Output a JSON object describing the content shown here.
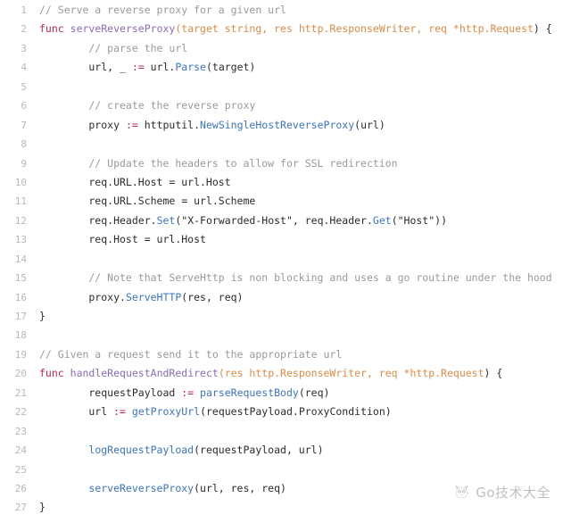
{
  "editor": {
    "language": "go",
    "background_color": "#ffffff",
    "line_number_color": "#b8b8b8",
    "default_text_color": "#2b2b2b",
    "first_line_number": 1,
    "last_line_number": 27,
    "total_lines": 27
  },
  "theme_colors": {
    "comment": "#9a9a9a",
    "keyword": "#c7254e",
    "function_name": "#8a6bbd",
    "parameter_type": "#e08a45",
    "function_call": "#3b74c4",
    "plain": "#2b2b2b",
    "operator": "#c7254e"
  },
  "watermark": {
    "icon": "wechat-gopher-icon",
    "text": "Go技术大全"
  },
  "lines": [
    {
      "number": "1",
      "tokens": [
        {
          "t": "comment",
          "s": "// Serve a reverse proxy for a given url"
        }
      ]
    },
    {
      "number": "2",
      "tokens": [
        {
          "t": "keyword",
          "s": "func"
        },
        {
          "t": "plain",
          "s": " "
        },
        {
          "t": "fnname",
          "s": "serveReverseProxy"
        },
        {
          "t": "param",
          "s": "(target string, res http.ResponseWriter, req *http.Request"
        },
        {
          "t": "plain",
          "s": ") {"
        }
      ]
    },
    {
      "number": "3",
      "tokens": [
        {
          "t": "comment",
          "s": "        // parse the url"
        }
      ]
    },
    {
      "number": "4",
      "tokens": [
        {
          "t": "plain",
          "s": "        url, _ "
        },
        {
          "t": "operator",
          "s": ":="
        },
        {
          "t": "plain",
          "s": " url."
        },
        {
          "t": "call",
          "s": "Parse"
        },
        {
          "t": "plain",
          "s": "(target)"
        }
      ]
    },
    {
      "number": "5",
      "tokens": [
        {
          "t": "plain",
          "s": ""
        }
      ]
    },
    {
      "number": "6",
      "tokens": [
        {
          "t": "comment",
          "s": "        // create the reverse proxy"
        }
      ]
    },
    {
      "number": "7",
      "tokens": [
        {
          "t": "plain",
          "s": "        proxy "
        },
        {
          "t": "operator",
          "s": ":="
        },
        {
          "t": "plain",
          "s": " httputil."
        },
        {
          "t": "call",
          "s": "NewSingleHostReverseProxy"
        },
        {
          "t": "plain",
          "s": "(url)"
        }
      ]
    },
    {
      "number": "8",
      "tokens": [
        {
          "t": "plain",
          "s": ""
        }
      ]
    },
    {
      "number": "9",
      "tokens": [
        {
          "t": "comment",
          "s": "        // Update the headers to allow for SSL redirection"
        }
      ]
    },
    {
      "number": "10",
      "tokens": [
        {
          "t": "plain",
          "s": "        req.URL.Host = url.Host"
        }
      ]
    },
    {
      "number": "11",
      "tokens": [
        {
          "t": "plain",
          "s": "        req.URL.Scheme = url.Scheme"
        }
      ]
    },
    {
      "number": "12",
      "tokens": [
        {
          "t": "plain",
          "s": "        req.Header."
        },
        {
          "t": "call",
          "s": "Set"
        },
        {
          "t": "plain",
          "s": "(\"X-Forwarded-Host\", req.Header."
        },
        {
          "t": "call",
          "s": "Get"
        },
        {
          "t": "plain",
          "s": "(\"Host\"))"
        }
      ]
    },
    {
      "number": "13",
      "tokens": [
        {
          "t": "plain",
          "s": "        req.Host = url.Host"
        }
      ]
    },
    {
      "number": "14",
      "tokens": [
        {
          "t": "plain",
          "s": ""
        }
      ]
    },
    {
      "number": "15",
      "tokens": [
        {
          "t": "comment",
          "s": "        // Note that ServeHttp is non blocking and uses a go routine under the hood"
        }
      ]
    },
    {
      "number": "16",
      "tokens": [
        {
          "t": "plain",
          "s": "        proxy."
        },
        {
          "t": "call",
          "s": "ServeHTTP"
        },
        {
          "t": "plain",
          "s": "(res, req)"
        }
      ]
    },
    {
      "number": "17",
      "tokens": [
        {
          "t": "plain",
          "s": "}"
        }
      ]
    },
    {
      "number": "18",
      "tokens": [
        {
          "t": "plain",
          "s": ""
        }
      ]
    },
    {
      "number": "19",
      "tokens": [
        {
          "t": "comment",
          "s": "// Given a request send it to the appropriate url"
        }
      ]
    },
    {
      "number": "20",
      "tokens": [
        {
          "t": "keyword",
          "s": "func"
        },
        {
          "t": "plain",
          "s": " "
        },
        {
          "t": "fnname",
          "s": "handleRequestAndRedirect"
        },
        {
          "t": "param",
          "s": "(res http.ResponseWriter, req *http.Request"
        },
        {
          "t": "plain",
          "s": ") {"
        }
      ]
    },
    {
      "number": "21",
      "tokens": [
        {
          "t": "plain",
          "s": "        requestPayload "
        },
        {
          "t": "operator",
          "s": ":="
        },
        {
          "t": "plain",
          "s": " "
        },
        {
          "t": "call",
          "s": "parseRequestBody"
        },
        {
          "t": "plain",
          "s": "(req)"
        }
      ]
    },
    {
      "number": "22",
      "tokens": [
        {
          "t": "plain",
          "s": "        url "
        },
        {
          "t": "operator",
          "s": ":="
        },
        {
          "t": "plain",
          "s": " "
        },
        {
          "t": "call",
          "s": "getProxyUrl"
        },
        {
          "t": "plain",
          "s": "(requestPayload.ProxyCondition)"
        }
      ]
    },
    {
      "number": "23",
      "tokens": [
        {
          "t": "plain",
          "s": ""
        }
      ]
    },
    {
      "number": "24",
      "tokens": [
        {
          "t": "plain",
          "s": "        "
        },
        {
          "t": "call",
          "s": "logRequestPayload"
        },
        {
          "t": "plain",
          "s": "(requestPayload, url)"
        }
      ]
    },
    {
      "number": "25",
      "tokens": [
        {
          "t": "plain",
          "s": ""
        }
      ]
    },
    {
      "number": "26",
      "tokens": [
        {
          "t": "plain",
          "s": "        "
        },
        {
          "t": "call",
          "s": "serveReverseProxy"
        },
        {
          "t": "plain",
          "s": "(url, res, req)"
        }
      ]
    },
    {
      "number": "27",
      "tokens": [
        {
          "t": "plain",
          "s": "}"
        }
      ]
    }
  ]
}
